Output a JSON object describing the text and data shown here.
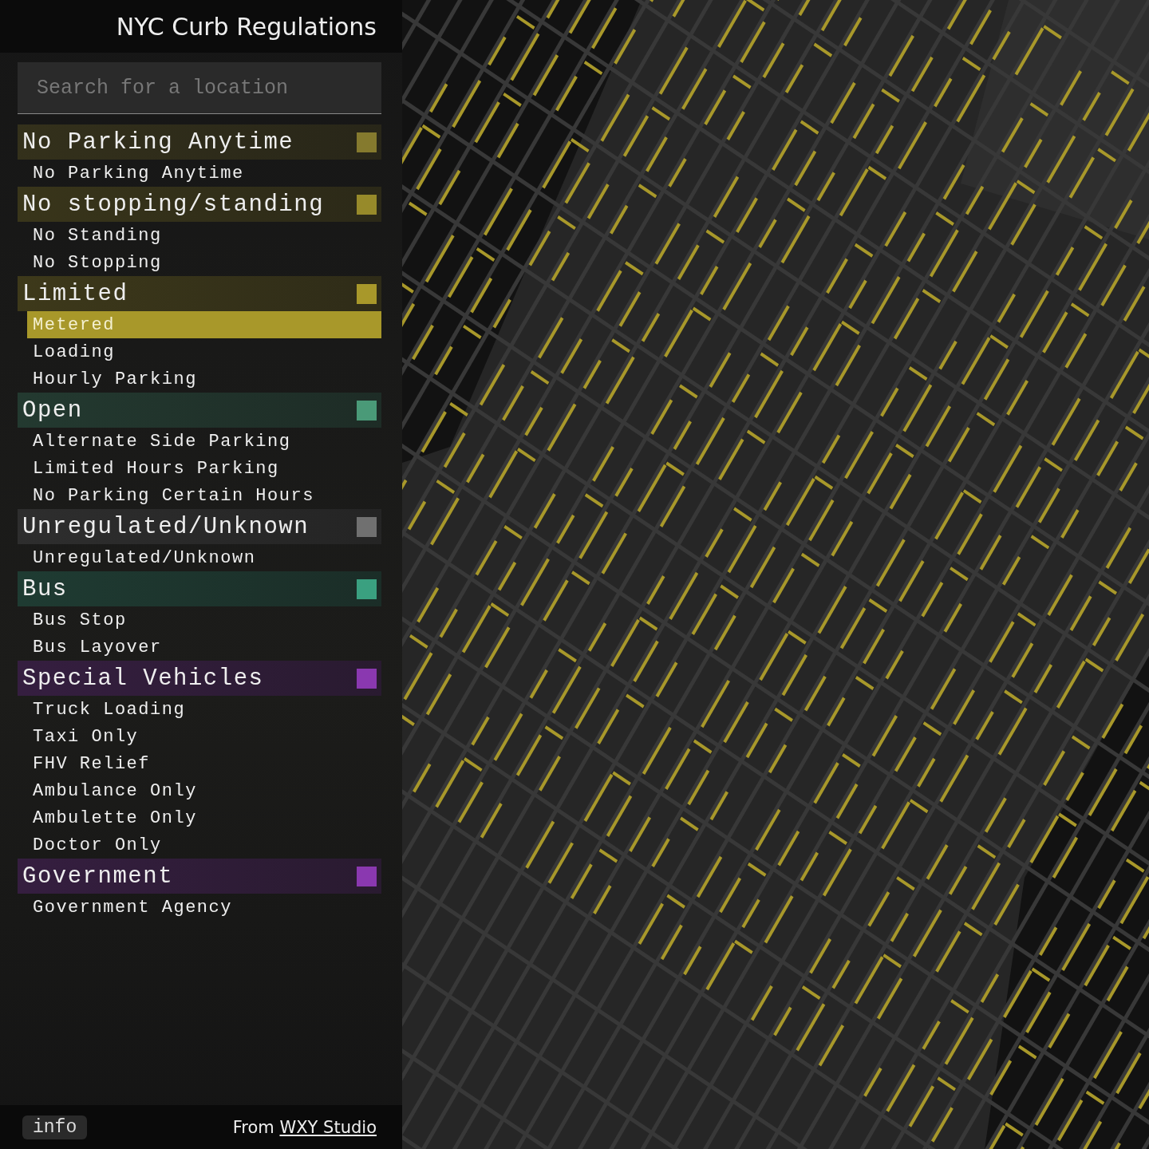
{
  "sidebar": {
    "title": "NYC Curb Regulations",
    "search": {
      "placeholder": "Search for a location"
    },
    "groups": [
      {
        "label": "No Parking Anytime",
        "color": "#857a2e",
        "items": [
          {
            "label": "No Parking Anytime",
            "selected": false
          }
        ]
      },
      {
        "label": "No stopping/standing",
        "color": "#978a2a",
        "items": [
          {
            "label": "No Standing",
            "selected": false
          },
          {
            "label": "No Stopping",
            "selected": false
          }
        ]
      },
      {
        "label": "Limited",
        "color": "#a8982a",
        "items": [
          {
            "label": "Metered",
            "selected": true
          },
          {
            "label": "Loading",
            "selected": false
          },
          {
            "label": "Hourly Parking",
            "selected": false
          }
        ]
      },
      {
        "label": "Open",
        "color": "#4a9a78",
        "items": [
          {
            "label": "Alternate Side Parking",
            "selected": false
          },
          {
            "label": "Limited Hours Parking",
            "selected": false
          },
          {
            "label": "No Parking Certain Hours",
            "selected": false
          }
        ]
      },
      {
        "label": "Unregulated/Unknown",
        "color": "#707070",
        "items": [
          {
            "label": "Unregulated/Unknown",
            "selected": false
          }
        ]
      },
      {
        "label": "Bus",
        "color": "#3aa080",
        "items": [
          {
            "label": "Bus Stop",
            "selected": false
          },
          {
            "label": "Bus Layover",
            "selected": false
          }
        ]
      },
      {
        "label": "Special Vehicles",
        "color": "#8a38b0",
        "items": [
          {
            "label": "Truck Loading",
            "selected": false
          },
          {
            "label": "Taxi Only",
            "selected": false
          },
          {
            "label": "FHV Relief",
            "selected": false
          },
          {
            "label": "Ambulance Only",
            "selected": false
          },
          {
            "label": "Ambulette Only",
            "selected": false
          },
          {
            "label": "Doctor Only",
            "selected": false
          }
        ]
      },
      {
        "label": "Government",
        "color": "#8a38b0",
        "items": [
          {
            "label": "Government Agency",
            "selected": false
          }
        ]
      }
    ],
    "footer": {
      "info_button": "info",
      "credit": "From",
      "credit_link": "WXY Studio"
    }
  }
}
